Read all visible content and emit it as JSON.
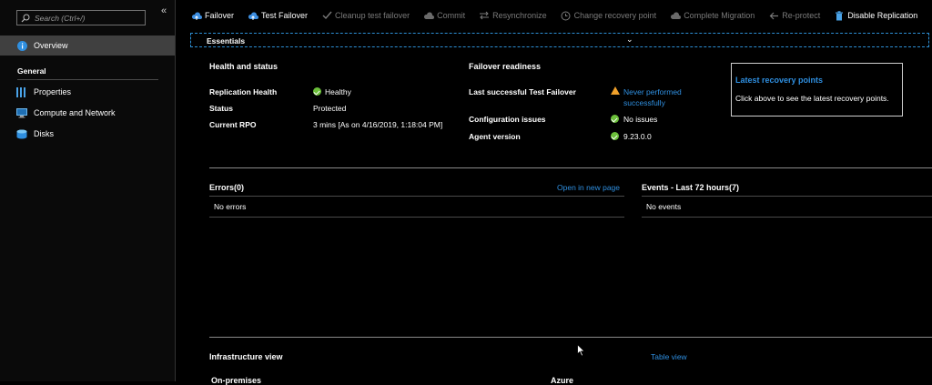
{
  "sidebar": {
    "search_placeholder": "Search (Ctrl+/)",
    "collapse": "«",
    "items": [
      {
        "label": "Overview"
      },
      {
        "label": "Properties"
      },
      {
        "label": "Compute and Network"
      },
      {
        "label": "Disks"
      }
    ],
    "section": "General"
  },
  "toolbar": {
    "failover": "Failover",
    "test_failover": "Test Failover",
    "cleanup": "Cleanup test failover",
    "commit": "Commit",
    "resync": "Resynchronize",
    "change_rp": "Change recovery point",
    "complete_migration": "Complete Migration",
    "reprotect": "Re-protect",
    "disable": "Disable Replication"
  },
  "essentials": {
    "label": "Essentials",
    "chevron": "⌄"
  },
  "health": {
    "heading": "Health and status",
    "rows": [
      {
        "key": "Replication Health",
        "value": "Healthy"
      },
      {
        "key": "Status",
        "value": "Protected"
      },
      {
        "key": "Current RPO",
        "value": "3 mins [As on 4/16/2019, 1:18:04 PM]"
      }
    ]
  },
  "failover_readiness": {
    "heading": "Failover readiness",
    "rows": [
      {
        "key": "Last successful Test Failover",
        "value_line1": "Never performed",
        "value_line2": "successfully"
      },
      {
        "key": "Configuration issues",
        "value": "No issues"
      },
      {
        "key": "Agent version",
        "value": "9.23.0.0"
      }
    ]
  },
  "recovery_card": {
    "title": "Latest recovery points",
    "description": "Click above to see the latest recovery points."
  },
  "errors": {
    "heading": "Errors(0)",
    "link": "Open in new page",
    "empty": "No errors"
  },
  "events": {
    "heading": "Events - Last 72 hours(7)",
    "empty": "No events"
  },
  "infrastructure": {
    "heading": "Infrastructure view",
    "link": "Table view",
    "col_left": "On-premises",
    "col_right": "Azure"
  },
  "colors": {
    "accent": "#2f8fe0",
    "ok": "#6bbf3a",
    "warning": "#f1a12b",
    "active_nav": "#404040"
  }
}
